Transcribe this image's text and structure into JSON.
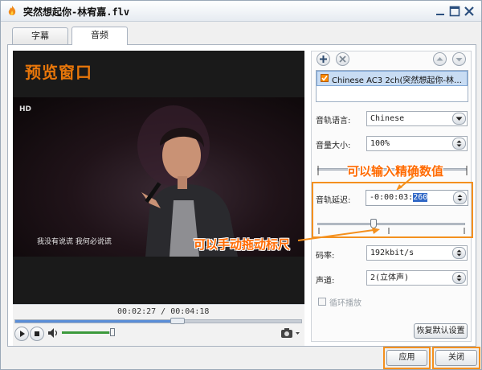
{
  "window": {
    "title": "突然想起你-林宥嘉.flv"
  },
  "tabs": [
    {
      "label": "字幕",
      "active": false
    },
    {
      "label": "音频",
      "active": true
    }
  ],
  "preview": {
    "label": "预览窗口",
    "subtitle": "我没有说谎 我何必说谎",
    "channel_logo": "HD",
    "time_current": "00:02:27",
    "time_total": "00:04:18",
    "time_display": "00:02:27 / 00:04:18",
    "seek_progress": 0.57,
    "volume_level": 0.95
  },
  "audio": {
    "track_checked": true,
    "track_name": "Chinese AC3 2ch(突然想起你-林宥嘉.flv)",
    "language_label": "音轨语言:",
    "language_value": "Chinese",
    "volume_label": "音量大小:",
    "volume_value": "100%",
    "delay_label": "音轨延迟:",
    "delay_prefix": "-0:00:03:",
    "delay_selected": "260",
    "delay_slider_position": 0.38,
    "bitrate_label": "码率:",
    "bitrate_value": "192kbit/s",
    "channel_label": "声道:",
    "channel_value": "2(立体声)",
    "loop_label": "循环播放",
    "loop_checked": false,
    "restore_label": "恢复默认设置"
  },
  "annotations": {
    "input_hint": "可以输入精确数值",
    "drag_hint": "可以手动拖动标尺"
  },
  "buttons": {
    "apply": "应用",
    "close": "关闭"
  },
  "colors": {
    "accent_orange": "#f4901e",
    "hint_orange": "#ff6a00",
    "selection_blue": "#3168c6",
    "seek_blue": "#5a8ed8",
    "volume_green": "#3c9a3c"
  },
  "icons": {
    "app": "flame-icon",
    "minimize": "minimize-icon",
    "maximize": "maximize-icon",
    "close": "close-icon",
    "add": "plus-icon",
    "remove": "x-icon",
    "move_up": "arrow-up-icon",
    "move_down": "arrow-down-icon",
    "play": "play-icon",
    "stop": "stop-icon",
    "volume": "speaker-icon",
    "camera": "camera-icon"
  }
}
